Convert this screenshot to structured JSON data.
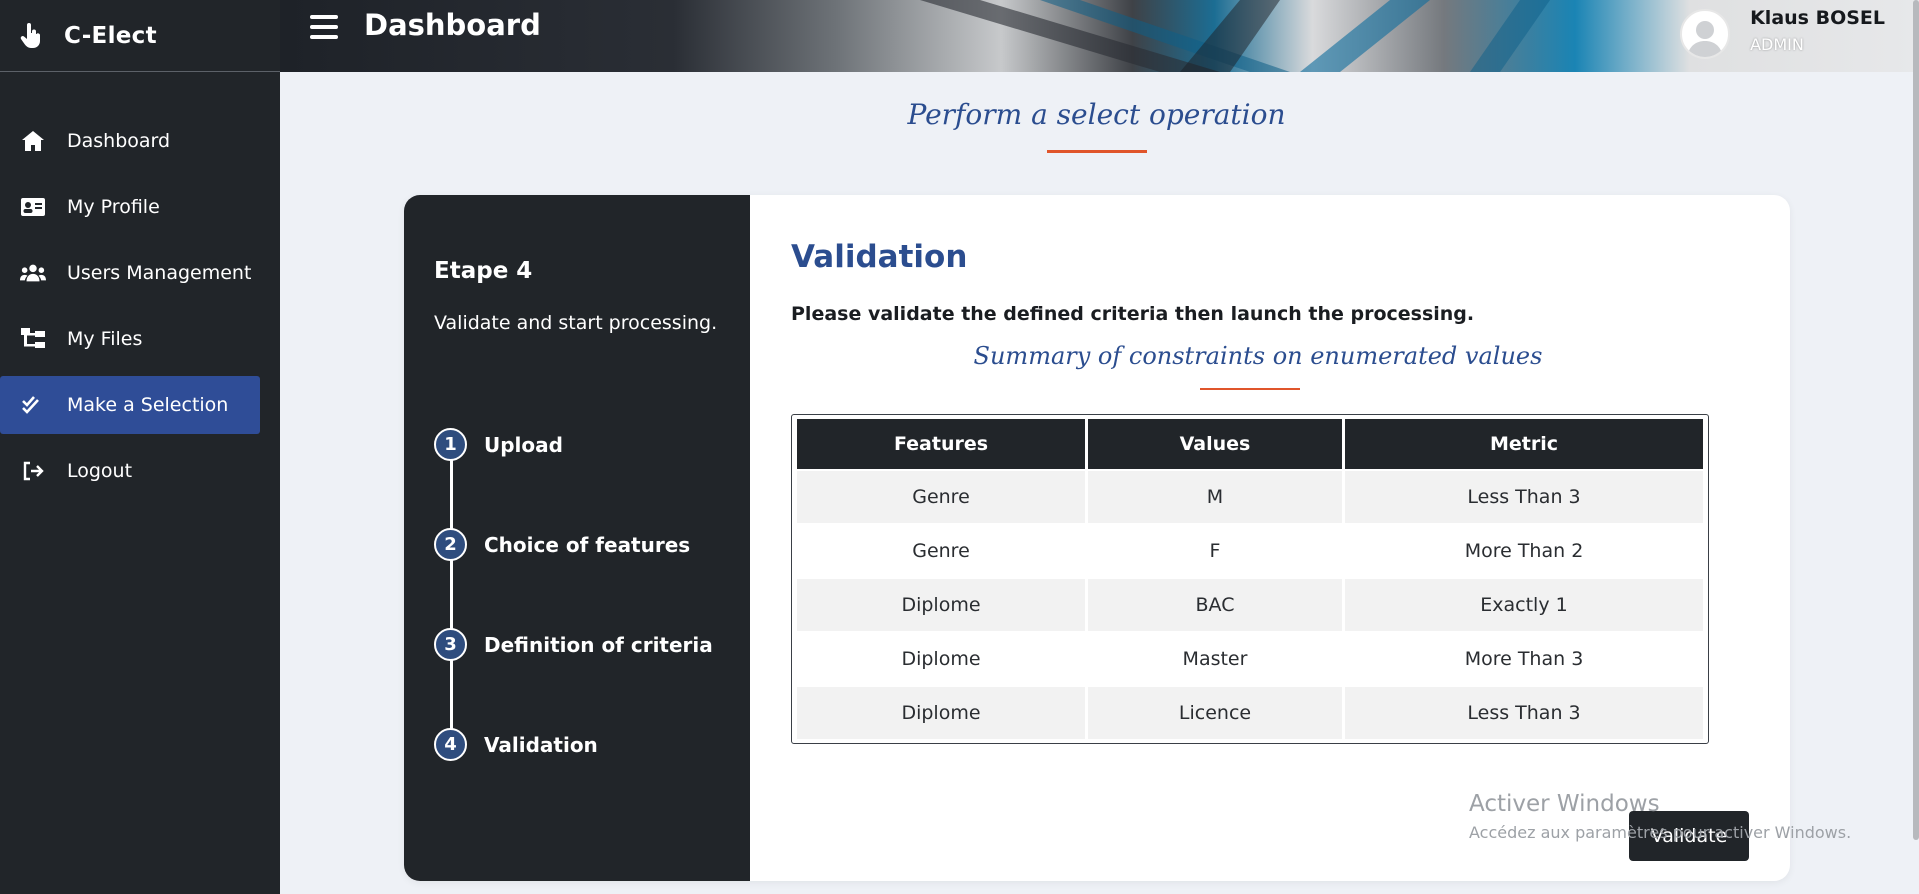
{
  "app": {
    "name": "C-Elect"
  },
  "sidebar": {
    "items": [
      {
        "label": "Dashboard",
        "icon": "home-icon",
        "active": false
      },
      {
        "label": "My Profile",
        "icon": "id-card-icon",
        "active": false
      },
      {
        "label": "Users Management",
        "icon": "users-icon",
        "active": false
      },
      {
        "label": "My Files",
        "icon": "sitemap-icon",
        "active": false
      },
      {
        "label": "Make a Selection",
        "icon": "check-double-icon",
        "active": true
      },
      {
        "label": "Logout",
        "icon": "sign-out-icon",
        "active": false
      }
    ]
  },
  "topbar": {
    "title": "Dashboard",
    "user": {
      "name": "Klaus BOSEL",
      "role": "ADMIN"
    }
  },
  "page": {
    "heading": "Perform a select operation"
  },
  "steps": {
    "etape": "Etape 4",
    "etape_desc": "Validate and start processing.",
    "items": [
      {
        "num": "1",
        "label": "Upload"
      },
      {
        "num": "2",
        "label": "Choice of features"
      },
      {
        "num": "3",
        "label": "Definition of criteria"
      },
      {
        "num": "4",
        "label": "Validation"
      }
    ]
  },
  "validation": {
    "title": "Validation",
    "description": "Please validate the defined criteria then launch the processing.",
    "summary_title": "Summary of constraints on enumerated values",
    "table": {
      "headers": [
        "Features",
        "Values",
        "Metric"
      ],
      "rows": [
        [
          "Genre",
          "M",
          "Less Than 3"
        ],
        [
          "Genre",
          "F",
          "More Than 2"
        ],
        [
          "Diplome",
          "BAC",
          "Exactly 1"
        ],
        [
          "Diplome",
          "Master",
          "More Than 3"
        ],
        [
          "Diplome",
          "Licence",
          "Less Than 3"
        ]
      ]
    },
    "validate_label": "Validate"
  },
  "watermark": {
    "line1": "Activer Windows",
    "line2": "Accédez aux paramètres pour activer Windows."
  },
  "colors": {
    "sidebar_bg": "#212529",
    "active_nav": "#2f4d97",
    "accent_blue": "#2b4d8f",
    "accent_orange": "#e0552b"
  }
}
